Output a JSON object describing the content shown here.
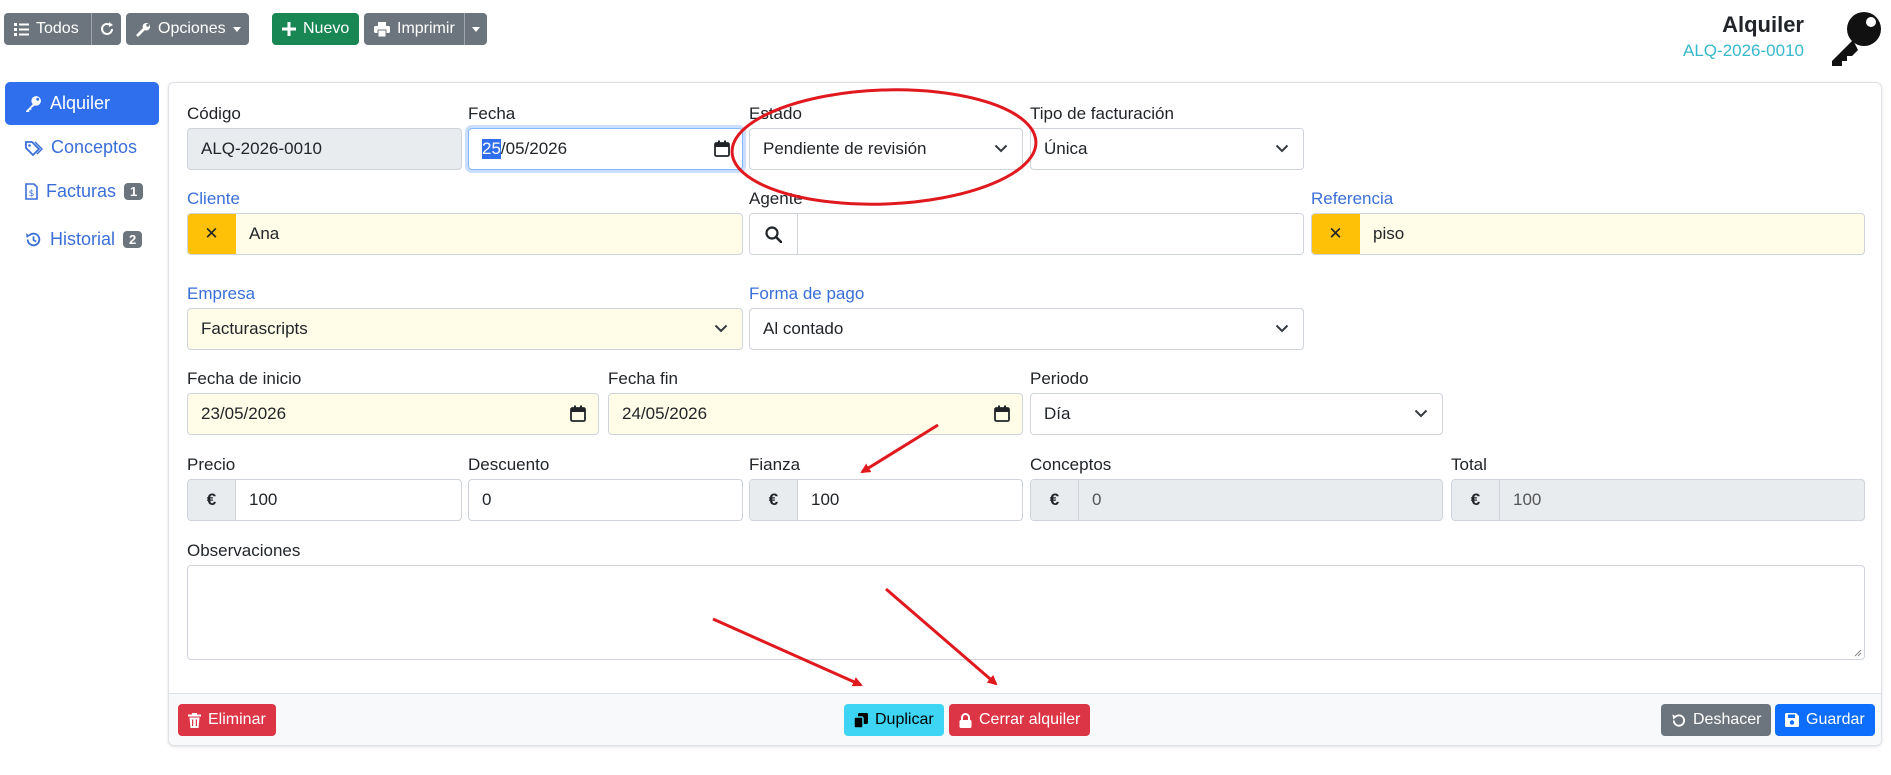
{
  "toolbar": {
    "all_label": "Todos",
    "options_label": "Opciones",
    "new_label": "Nuevo",
    "print_label": "Imprimir"
  },
  "header": {
    "title": "Alquiler",
    "code": "ALQ-2026-0010"
  },
  "sidebar": {
    "items": [
      {
        "label": "Alquiler",
        "icon": "key-icon",
        "active": true
      },
      {
        "label": "Conceptos",
        "icon": "tags-icon"
      },
      {
        "label": "Facturas",
        "icon": "invoice-icon",
        "badge": "1"
      },
      {
        "label": "Historial",
        "icon": "history-icon",
        "badge": "2"
      }
    ]
  },
  "form": {
    "codigo": {
      "label": "Código",
      "value": "ALQ-2026-0010"
    },
    "fecha": {
      "label": "Fecha",
      "value_day": "25",
      "value_rest": "/05/2026"
    },
    "estado": {
      "label": "Estado",
      "value": "Pendiente de revisión"
    },
    "tipo_facturacion": {
      "label": "Tipo de facturación",
      "value": "Única"
    },
    "cliente": {
      "label": "Cliente",
      "value": "Ana"
    },
    "agente": {
      "label": "Agente",
      "value": ""
    },
    "referencia": {
      "label": "Referencia",
      "value": "piso"
    },
    "empresa": {
      "label": "Empresa",
      "value": "Facturascripts"
    },
    "forma_pago": {
      "label": "Forma de pago",
      "value": "Al contado"
    },
    "fecha_inicio": {
      "label": "Fecha de inicio",
      "value": "23/05/2026"
    },
    "fecha_fin": {
      "label": "Fecha fin",
      "value": "24/05/2026"
    },
    "periodo": {
      "label": "Periodo",
      "value": "Día"
    },
    "precio": {
      "label": "Precio",
      "value": "100"
    },
    "descuento": {
      "label": "Descuento",
      "value": "0"
    },
    "fianza": {
      "label": "Fianza",
      "value": "100"
    },
    "conceptos": {
      "label": "Conceptos",
      "value": "0"
    },
    "total": {
      "label": "Total",
      "value": "100"
    },
    "observaciones": {
      "label": "Observaciones",
      "value": ""
    },
    "currency_symbol": "€",
    "clear_symbol": "✕"
  },
  "footer": {
    "delete_label": "Eliminar",
    "duplicate_label": "Duplicar",
    "close_label": "Cerrar alquiler",
    "undo_label": "Deshacer",
    "save_label": "Guardar"
  },
  "colors": {
    "primary": "#2f6fed",
    "success": "#198754",
    "danger": "#dc3545",
    "info": "#3dd5f3",
    "secondary": "#6c757d",
    "warning": "#ffc107",
    "annotation": "#e0191e"
  }
}
